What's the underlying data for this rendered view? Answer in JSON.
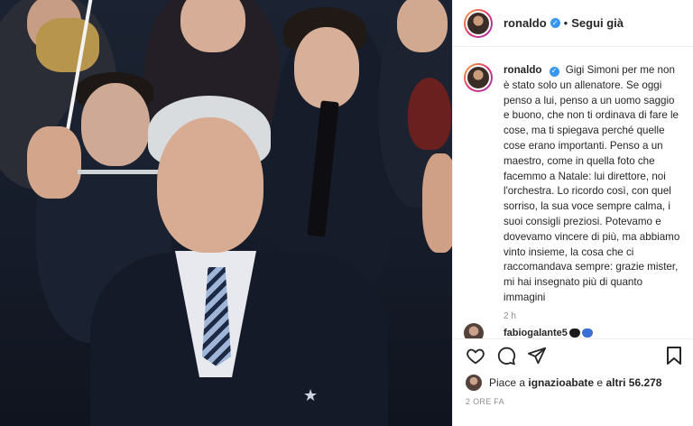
{
  "post": {
    "username": "ronaldo",
    "verified_icon": "verified-badge-icon",
    "separator": "•",
    "follow_label": "Segui già"
  },
  "caption": {
    "username": "ronaldo",
    "text": "Gigi Simoni per me non è stato solo un allenatore. Se oggi penso a lui, penso a un uomo saggio e buono, che non ti ordinava di fare le cose, ma ti spiegava perché quelle cose erano importanti. Penso a un maestro, come in quella foto che facemmo a Natale: lui direttore, noi l'orchestra. Lo ricordo così, con quel sorriso, la sua voce sempre calma, i suoi consigli preziosi. Potevamo e dovevamo vincere di più, ma abbiamo vinto insieme, la cosa che ci raccomandava sempre: grazie mister, mi hai insegnato più di quanto immagini",
    "time": "2 h"
  },
  "comment_peek": {
    "username": "fabiogalante5"
  },
  "actions": {
    "like_icon": "heart-icon",
    "comment_icon": "comment-icon",
    "share_icon": "share-icon",
    "save_icon": "bookmark-icon"
  },
  "likes": {
    "prefix": "Piace a ",
    "user": "ignazioabate",
    "middle": " e ",
    "count": "altri 56.278"
  },
  "date": "2 ORE FA",
  "colors": {
    "verified_blue": "#3897f0",
    "secondary_text": "#8e8e8e",
    "border": "#efefef"
  }
}
